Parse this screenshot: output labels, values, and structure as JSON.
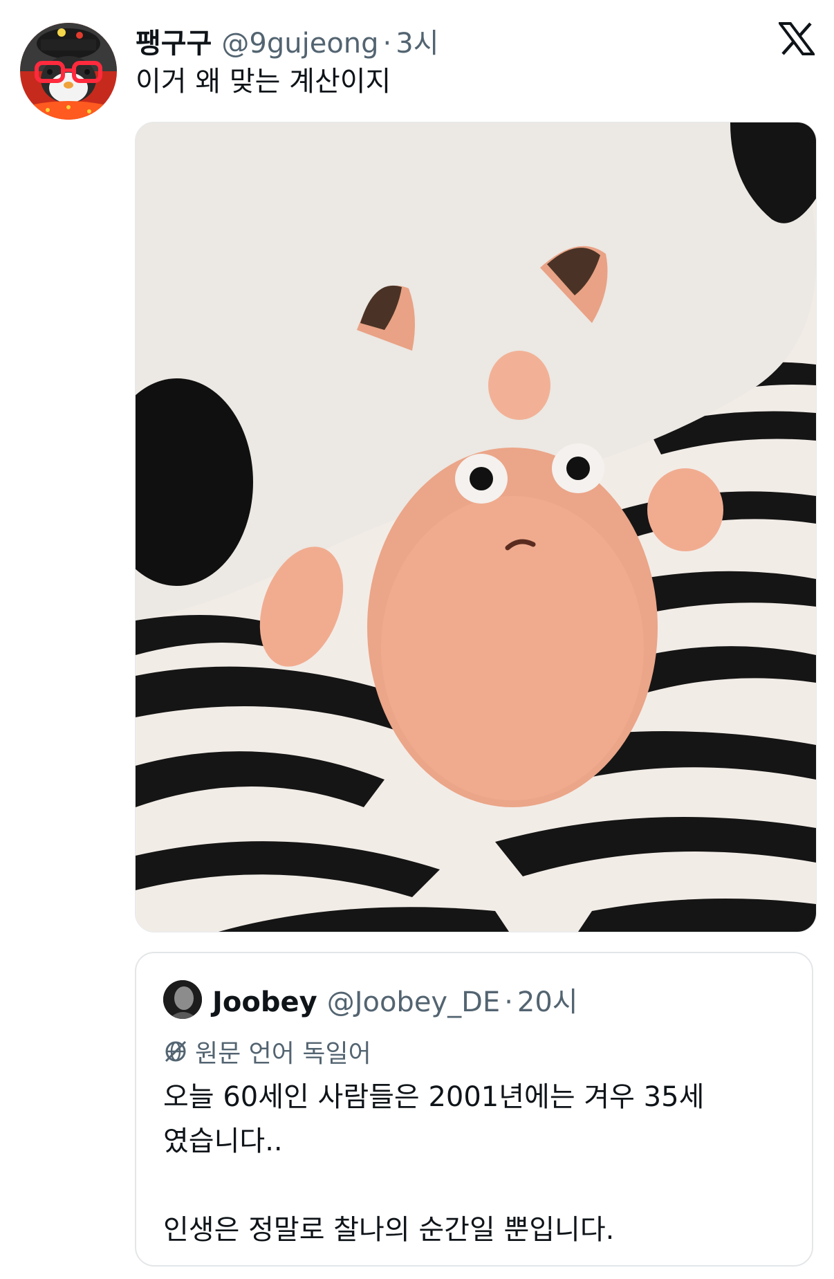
{
  "tweet": {
    "author": {
      "display_name": "팽구구",
      "handle": "@9gujeong",
      "separator": "·",
      "time": "3시"
    },
    "text": "이거 왜 맞는 계산이지",
    "platform_icon": "x-logo-icon",
    "media": {
      "kind": "photo",
      "icon": "felt-doll-photo"
    }
  },
  "quoted_tweet": {
    "author": {
      "display_name": "Joobey",
      "handle": "@Joobey_DE",
      "separator": "·",
      "time": "20시"
    },
    "translation_note": "원문 언어 독일어",
    "translation_icon": "globe-icon",
    "body": [
      "오늘 60세인 사람들은 2001년에는 겨우 35세",
      "였습니다..",
      "인생은 정말로 찰나의 순간일 뿐입니다."
    ]
  },
  "colors": {
    "text_primary": "#0f1419",
    "text_secondary": "#536471",
    "border": "#e3e6e8"
  }
}
